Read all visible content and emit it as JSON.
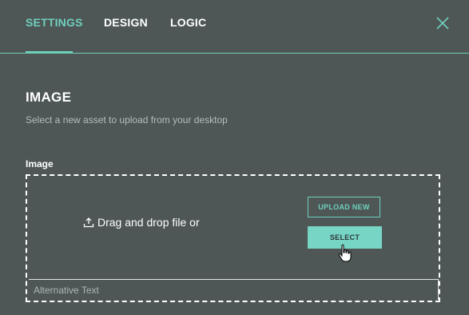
{
  "tabs": [
    {
      "label": "SETTINGS",
      "active": true
    },
    {
      "label": "DESIGN",
      "active": false
    },
    {
      "label": "LOGIC",
      "active": false
    }
  ],
  "close_icon": "close-icon",
  "section": {
    "title": "IMAGE",
    "subtitle": "Select a new asset to upload from your desktop"
  },
  "image_field": {
    "label": "Image",
    "drop_hint": "Drag and drop file or",
    "upload_icon": "upload-icon",
    "upload_new_label": "UPLOAD NEW",
    "select_label": "SELECT",
    "alt_text_placeholder": "Alternative Text"
  },
  "colors": {
    "background": "#4e5656",
    "accent": "#6fd0bd",
    "select_button": "#76d5c5",
    "text": "#ffffff",
    "muted_text": "#b4bcbc"
  }
}
